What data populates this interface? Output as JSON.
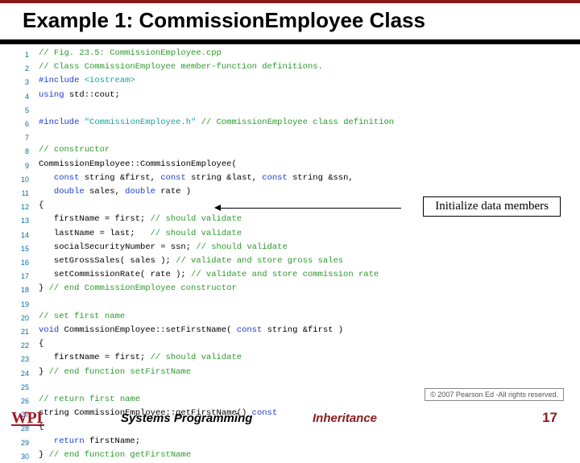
{
  "title": "Example 1: CommissionEmployee Class",
  "callout": "Initialize data members",
  "copyright": "© 2007 Pearson Ed -All rights reserved.",
  "logo": "WPI",
  "footer": {
    "left": "Systems Programming",
    "center": "Inheritance",
    "page": "17"
  },
  "code": [
    {
      "n": "1",
      "c": "// Fig. 23.5: CommissionEmployee.cpp",
      "cls": "cm"
    },
    {
      "n": "2",
      "c": "// Class CommissionEmployee member-function definitions.",
      "cls": "cm"
    },
    {
      "n": "3",
      "html": "<span class='kw'>#include</span> <span class='st'>&lt;iostream&gt;</span>"
    },
    {
      "n": "4",
      "html": "<span class='kw'>using</span> std::cout;"
    },
    {
      "n": "5",
      "c": ""
    },
    {
      "n": "6",
      "html": "<span class='kw'>#include</span> <span class='st'>\"CommissionEmployee.h\"</span> <span class='cm'>// CommissionEmployee class definition</span>"
    },
    {
      "n": "7",
      "c": ""
    },
    {
      "n": "8",
      "c": "// constructor",
      "cls": "cm"
    },
    {
      "n": "9",
      "c": "CommissionEmployee::CommissionEmployee("
    },
    {
      "n": "10",
      "html": "   <span class='kw'>const</span> string &amp;first, <span class='kw'>const</span> string &amp;last, <span class='kw'>const</span> string &amp;ssn,"
    },
    {
      "n": "11",
      "html": "   <span class='kw'>double</span> sales, <span class='kw'>double</span> rate )"
    },
    {
      "n": "12",
      "c": "{"
    },
    {
      "n": "13",
      "html": "   firstName = first; <span class='cm'>// should validate</span>"
    },
    {
      "n": "14",
      "html": "   lastName = last;   <span class='cm'>// should validate</span>"
    },
    {
      "n": "15",
      "html": "   socialSecurityNumber = ssn; <span class='cm'>// should validate</span>"
    },
    {
      "n": "16",
      "html": "   setGrossSales( sales ); <span class='cm'>// validate and store gross sales</span>"
    },
    {
      "n": "17",
      "html": "   setCommissionRate( rate ); <span class='cm'>// validate and store commission rate</span>"
    },
    {
      "n": "18",
      "html": "} <span class='cm'>// end CommissionEmployee constructor</span>"
    },
    {
      "n": "19",
      "c": ""
    },
    {
      "n": "20",
      "c": "// set first name",
      "cls": "cm"
    },
    {
      "n": "21",
      "html": "<span class='kw'>void</span> CommissionEmployee::setFirstName( <span class='kw'>const</span> string &amp;first )"
    },
    {
      "n": "22",
      "c": "{"
    },
    {
      "n": "23",
      "html": "   firstName = first; <span class='cm'>// should validate</span>"
    },
    {
      "n": "24",
      "html": "} <span class='cm'>// end function setFirstName</span>"
    },
    {
      "n": "25",
      "c": ""
    },
    {
      "n": "26",
      "c": "// return first name",
      "cls": "cm"
    },
    {
      "n": "27",
      "html": "string CommissionEmployee::getFirstName() <span class='kw'>const</span>"
    },
    {
      "n": "28",
      "c": "{"
    },
    {
      "n": "29",
      "html": "   <span class='kw'>return</span> firstName;"
    },
    {
      "n": "30",
      "html": "} <span class='cm'>// end function getFirstName</span>"
    }
  ]
}
